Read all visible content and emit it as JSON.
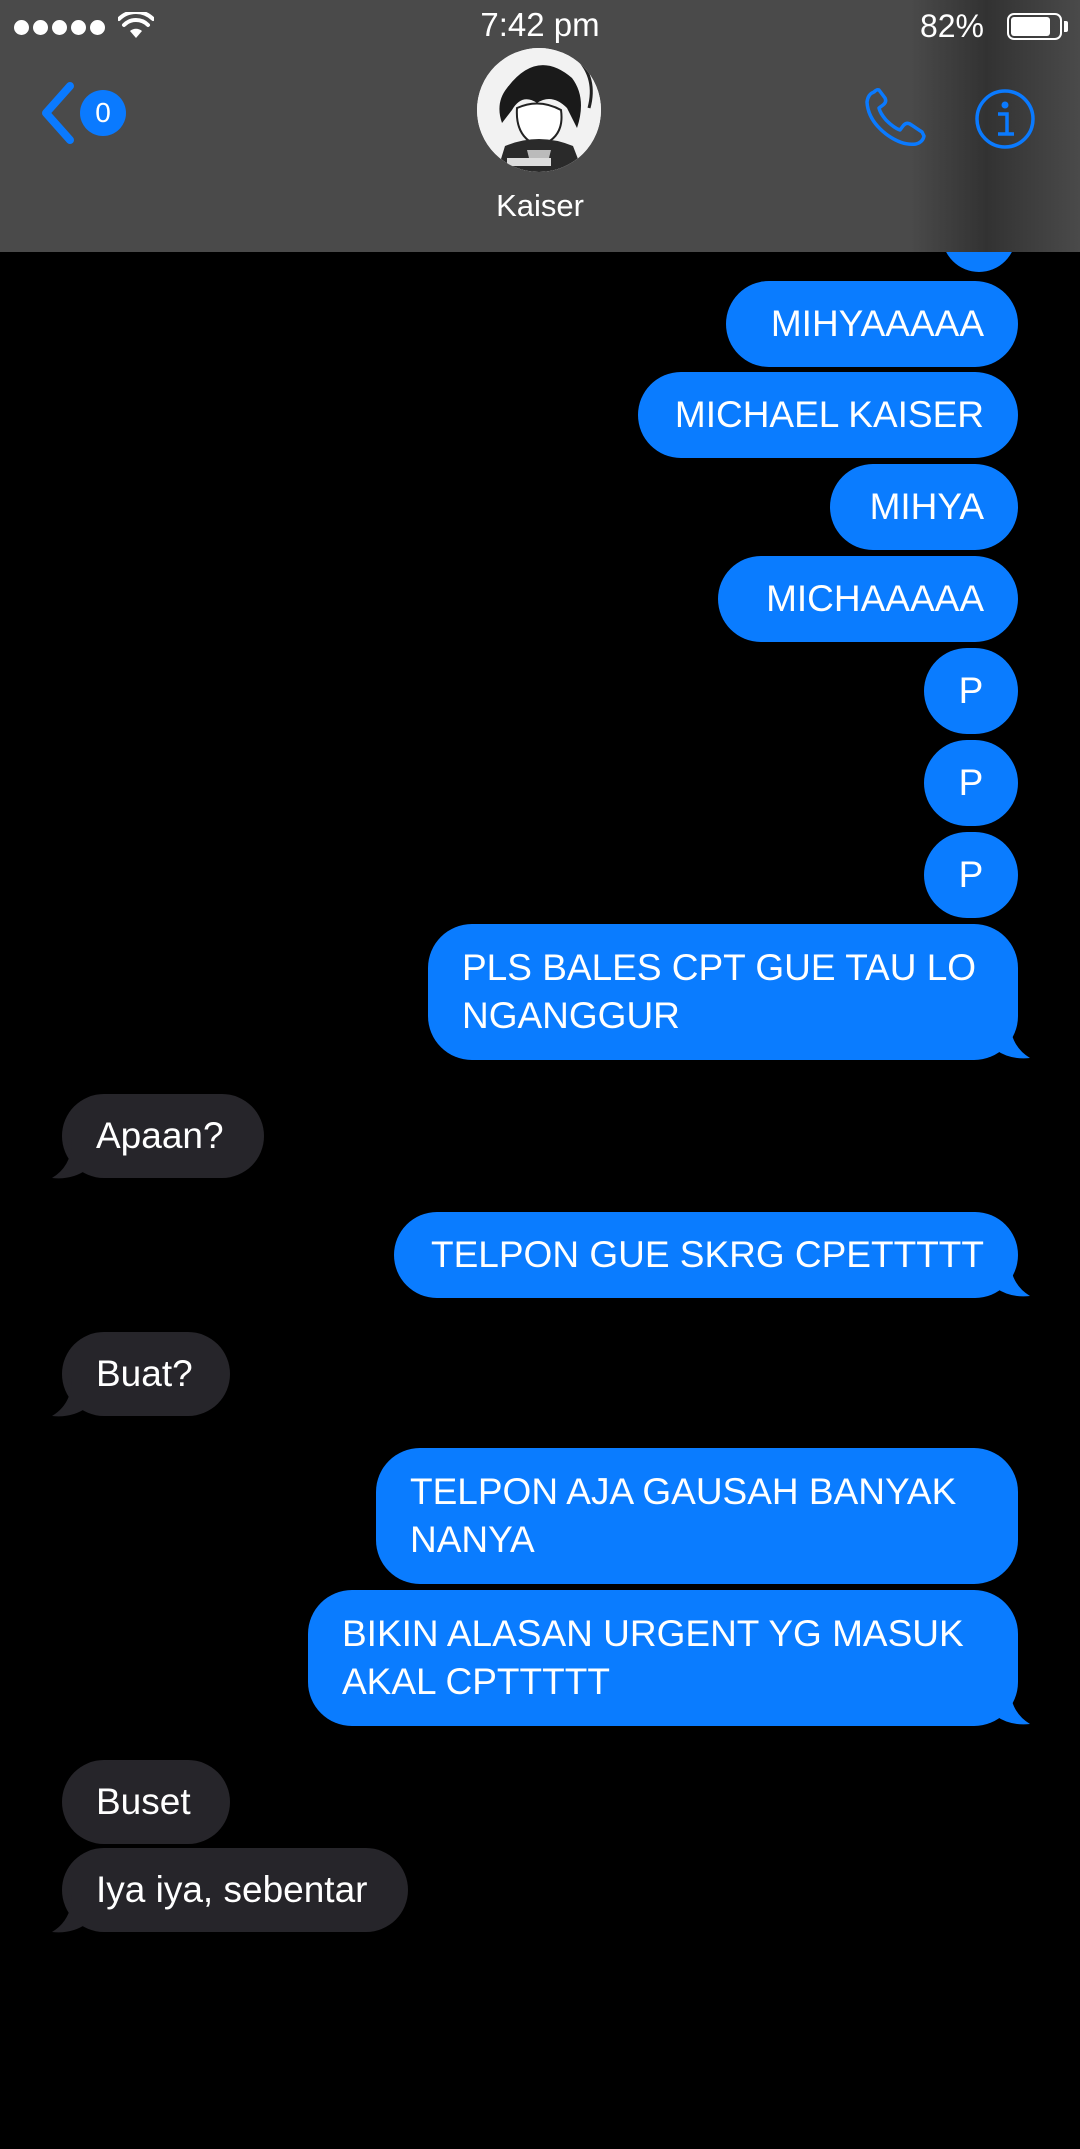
{
  "status_bar": {
    "time": "7:42 pm",
    "battery_percent": "82%",
    "battery_level": 0.82,
    "signal_bars": 5
  },
  "nav": {
    "back_badge": "0",
    "contact_name": "Kaiser"
  },
  "colors": {
    "sent_bubble": "#0a7cff",
    "received_bubble": "#26252a",
    "header_bg": "#4a4a4a",
    "accent": "#0a7aff"
  },
  "messages": [
    {
      "direction": "sent",
      "text": "MIHYAAAAA"
    },
    {
      "direction": "sent",
      "text": "MICHAEL KAISER"
    },
    {
      "direction": "sent",
      "text": "MIHYA"
    },
    {
      "direction": "sent",
      "text": "MICHAAAAA"
    },
    {
      "direction": "sent",
      "text": "P"
    },
    {
      "direction": "sent",
      "text": "P"
    },
    {
      "direction": "sent",
      "text": "P"
    },
    {
      "direction": "sent",
      "text": "PLS BALES CPT GUE TAU LO NGANGGUR"
    },
    {
      "direction": "received",
      "text": "Apaan?"
    },
    {
      "direction": "sent",
      "text": "TELPON GUE SKRG CPETTTTT"
    },
    {
      "direction": "received",
      "text": "Buat?"
    },
    {
      "direction": "sent",
      "text": "TELPON AJA GAUSAH BANYAK NANYA"
    },
    {
      "direction": "sent",
      "text": "BIKIN ALASAN URGENT YG MASUK AKAL CPTTTTT"
    },
    {
      "direction": "received",
      "text": "Buset"
    },
    {
      "direction": "received",
      "text": "Iya iya, sebentar"
    }
  ]
}
